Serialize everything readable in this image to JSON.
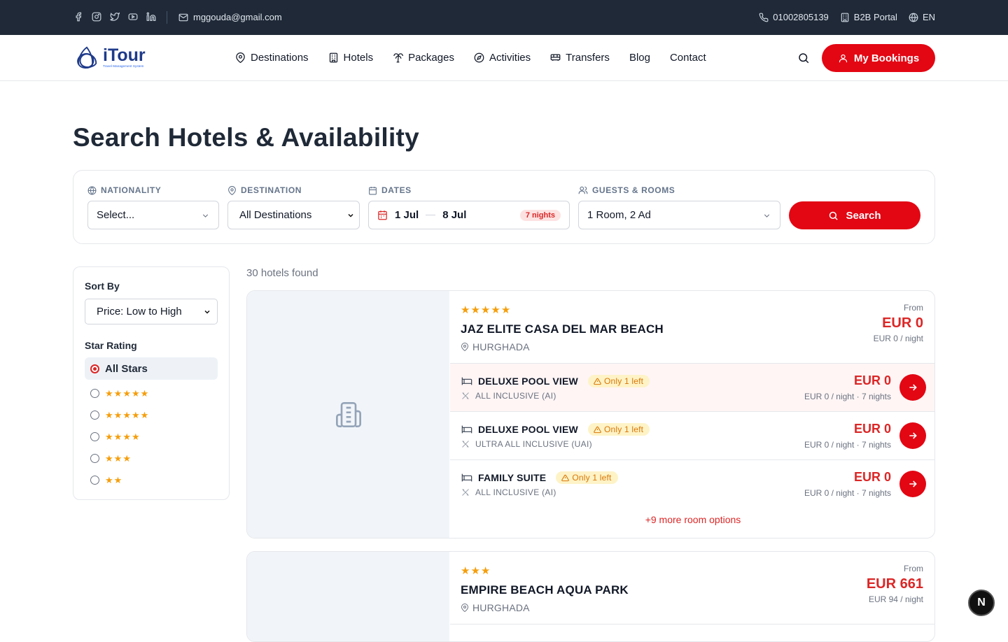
{
  "topbar": {
    "email": "mggouda@gmail.com",
    "phone": "01002805139",
    "b2b": "B2B Portal",
    "lang": "EN",
    "social_icons": [
      "facebook-icon",
      "instagram-icon",
      "twitter-icon",
      "youtube-icon",
      "linkedin-icon"
    ]
  },
  "brand": {
    "name_i": "i",
    "name_rest": "Tour",
    "tagline": "Travel Management System"
  },
  "nav": {
    "items": [
      {
        "label": "Destinations",
        "icon": "map-pin-icon"
      },
      {
        "label": "Hotels",
        "icon": "building-icon"
      },
      {
        "label": "Packages",
        "icon": "palm-tree-icon"
      },
      {
        "label": "Activities",
        "icon": "compass-icon"
      },
      {
        "label": "Transfers",
        "icon": "bus-icon"
      },
      {
        "label": "Blog",
        "icon": ""
      },
      {
        "label": "Contact",
        "icon": ""
      }
    ],
    "bookings_label": "My Bookings"
  },
  "page": {
    "title": "Search Hotels & Availability"
  },
  "search": {
    "nationality_label": "NATIONALITY",
    "nationality_value": "Select...",
    "destination_label": "DESTINATION",
    "destination_value": "All Destinations",
    "dates_label": "DATES",
    "date_from": "1 Jul",
    "date_to": "8 Jul",
    "nights": "7 nights",
    "guests_label": "GUESTS & ROOMS",
    "guests_value": "1 Room, 2 Ad",
    "search_label": "Search"
  },
  "filters": {
    "sort_label": "Sort By",
    "sort_value": "Price: Low to High",
    "star_label": "Star Rating",
    "all_stars": "All Stars",
    "star_options": [
      5,
      5,
      4,
      3,
      2
    ]
  },
  "results": {
    "count_text": "30 hotels found",
    "hotels": [
      {
        "stars": 5,
        "name": "JAZ ELITE CASA DEL MAR BEACH",
        "location": "HURGHADA",
        "from_label": "From",
        "price": "EUR 0",
        "per_night": "EUR 0 / night",
        "rooms": [
          {
            "name": "DELUXE POOL VIEW",
            "badge": "Only 1 left",
            "board": "ALL INCLUSIVE (AI)",
            "price": "EUR 0",
            "sub": "EUR 0 / night · 7 nights"
          },
          {
            "name": "DELUXE POOL VIEW",
            "badge": "Only 1 left",
            "board": "ULTRA ALL INCLUSIVE (UAI)",
            "price": "EUR 0",
            "sub": "EUR 0 / night · 7 nights"
          },
          {
            "name": "FAMILY SUITE",
            "badge": "Only 1 left",
            "board": "ALL INCLUSIVE (AI)",
            "price": "EUR 0",
            "sub": "EUR 0 / night · 7 nights"
          }
        ],
        "more_text": "+9 more room options"
      },
      {
        "stars": 3,
        "name": "EMPIRE BEACH AQUA PARK",
        "location": "HURGHADA",
        "from_label": "From",
        "price": "EUR 661",
        "per_night": "EUR 94 / night"
      }
    ]
  },
  "dev_badge": "N",
  "colors": {
    "brand_red": "#e30613",
    "topbar_bg": "#1f2937",
    "star": "#f59e0b",
    "navy": "#1e3a8a"
  }
}
